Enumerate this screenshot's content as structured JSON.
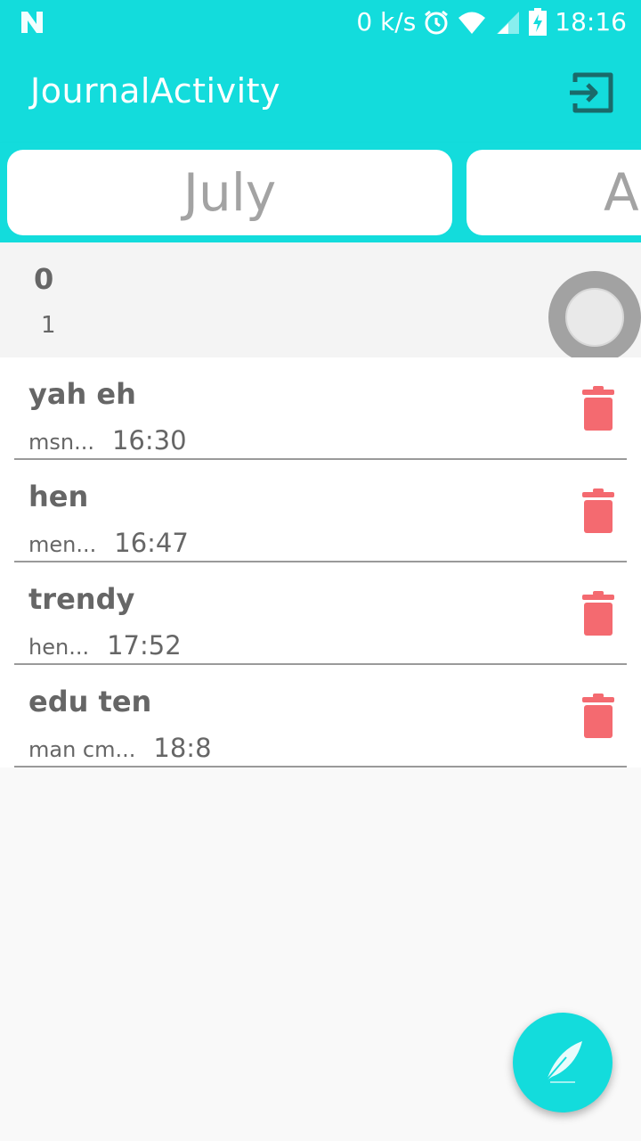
{
  "status_bar": {
    "network_speed": "0 k/s",
    "time": "18:16",
    "icons": [
      "notification-n-icon",
      "alarm-icon",
      "wifi-icon",
      "signal-icon",
      "battery-charging-icon"
    ]
  },
  "app_bar": {
    "title": "JournalActivity",
    "action_icon": "exit-icon"
  },
  "months": [
    {
      "label": "July"
    },
    {
      "label": "Au"
    }
  ],
  "summary": {
    "line1": "0",
    "line2": "1"
  },
  "entries": [
    {
      "title": "yah eh",
      "preview": "msn...",
      "time": "16:30"
    },
    {
      "title": "hen",
      "preview": "men...",
      "time": "16:47"
    },
    {
      "title": "trendy",
      "preview": "hen...",
      "time": "17:52"
    },
    {
      "title": "edu ten",
      "preview": "man cm...",
      "time": "18:8"
    }
  ],
  "colors": {
    "primary": "#13dcdc",
    "delete": "#f46a70",
    "text": "#666666"
  },
  "fab": {
    "icon": "feather-pen-icon"
  }
}
